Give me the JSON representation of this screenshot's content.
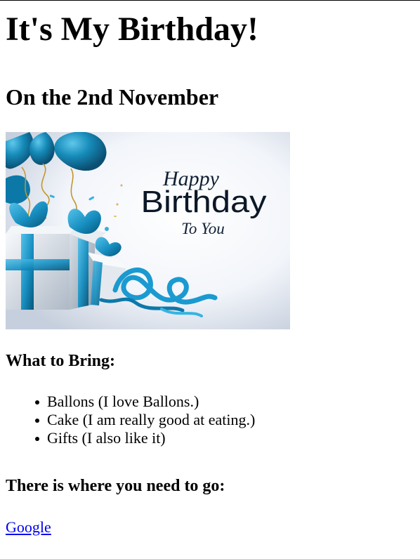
{
  "page": {
    "title": "It's My Birthday!",
    "subtitle": "On the 2nd November"
  },
  "image": {
    "line1": "Happy",
    "line2": "Birthday",
    "line3": "To You"
  },
  "bring": {
    "heading": "What to Bring:",
    "items": [
      "Ballons (I love Ballons.)",
      "Cake (I am really good at eating.)",
      "Gifts (I also like it)"
    ]
  },
  "directions": {
    "heading": "There is where you need to go:",
    "link_label": "Google"
  },
  "colors": {
    "text": "#000000",
    "link": "#0000ee",
    "accent_blue": "#1d8fc3"
  }
}
